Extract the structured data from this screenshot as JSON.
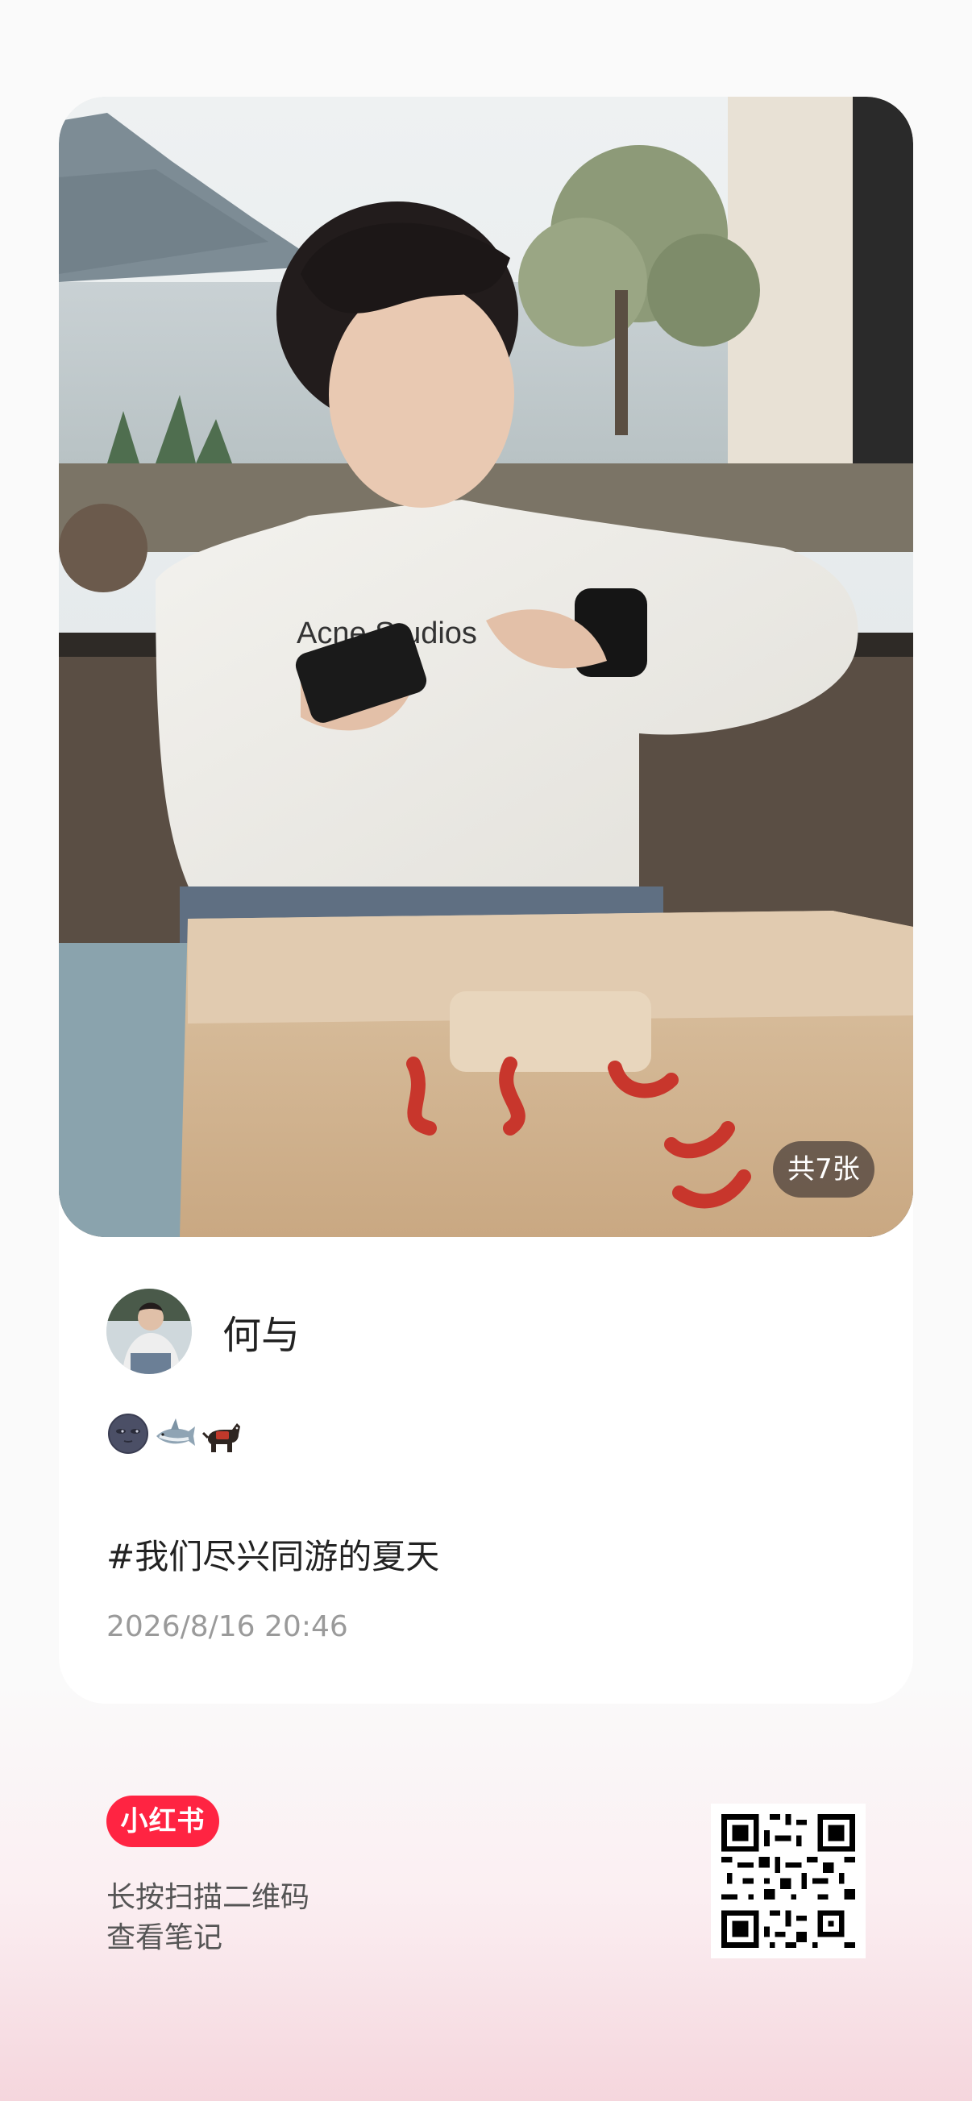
{
  "post": {
    "image_count_label": "共7张",
    "author_name": "何与",
    "emoji_icons": [
      "dark-moon-emoji",
      "shark-emoji",
      "service-dog-emoji"
    ],
    "hashtag_text": "#我们尽兴同游的夏天",
    "timestamp": "2026/8/16 20:46"
  },
  "footer": {
    "logo_text": "小红书",
    "instruction_line1": "长按扫描二维码",
    "instruction_line2": "查看笔记"
  },
  "colors": {
    "brand_red": "#ff2442",
    "card_bg": "#ffffff",
    "page_bg": "#fafafa",
    "text_primary": "#222222",
    "text_secondary": "#9a9a9a"
  }
}
